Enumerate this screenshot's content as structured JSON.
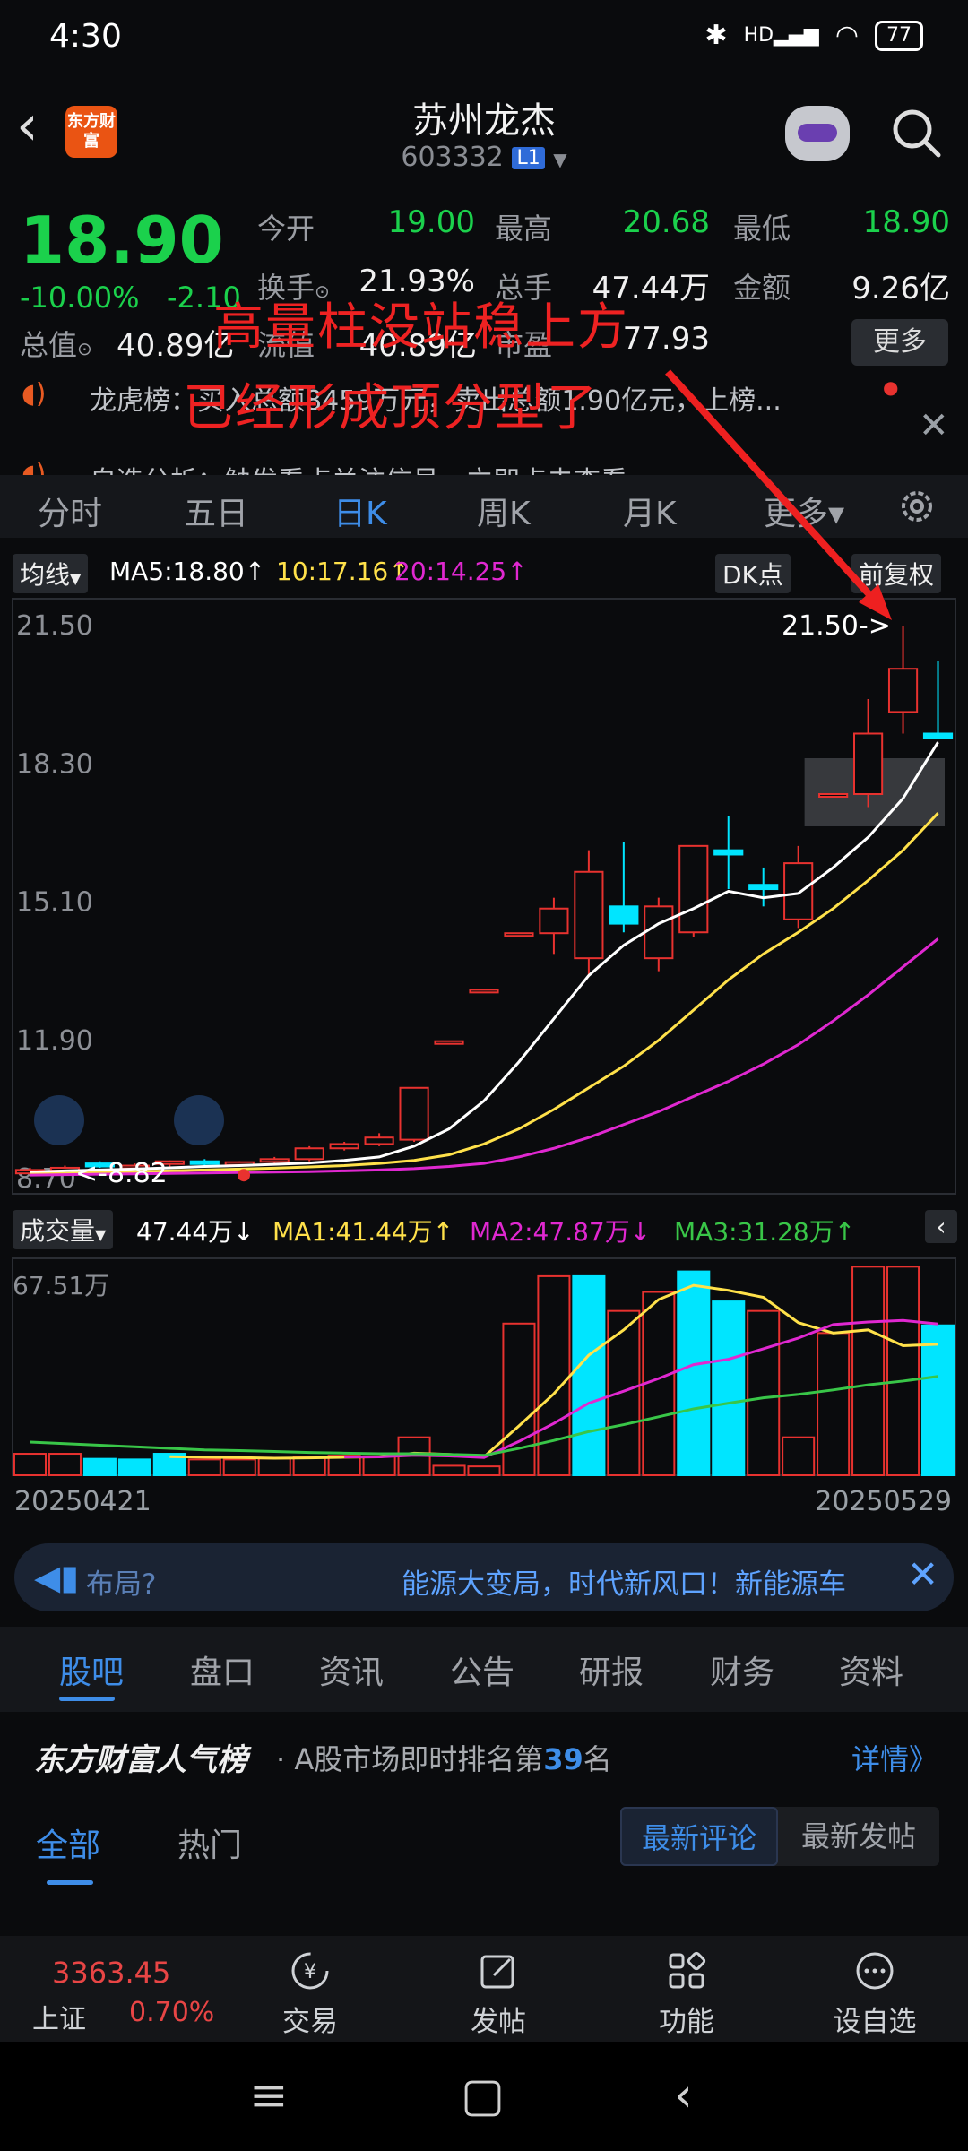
{
  "status_bar": {
    "time": "4:30",
    "network": "HD",
    "battery": "77"
  },
  "header": {
    "app_logo_text": "东方财富",
    "stock_name": "苏州龙杰",
    "stock_code": "603332",
    "level_badge": "L1"
  },
  "quote": {
    "price": "18.90",
    "change_pct": "-10.00%",
    "change": "-2.10",
    "fields": {
      "open_label": "今开",
      "open": "19.00",
      "high_label": "最高",
      "high": "20.68",
      "low_label": "最低",
      "low": "18.90",
      "turnover_label": "换手",
      "turnover": "21.93%",
      "volume_label": "总手",
      "volume": "47.44万",
      "amount_label": "金额",
      "amount": "9.26亿",
      "mcap_label": "总值",
      "mcap": "40.89亿",
      "float_label": "流值",
      "float": "40.89亿",
      "pe_label": "市盈",
      "pe": "77.93"
    },
    "more_label": "更多"
  },
  "annotations": {
    "line1": "高量柱没站稳上方",
    "line2": "已经形成顶分型了"
  },
  "tickers": [
    {
      "text": "龙虎榜：买入总额8459万元，卖出总额1.90亿元，上榜..."
    },
    {
      "text": "自选分析：触发看点关注信号，立即点击查看"
    }
  ],
  "period_tabs": [
    "分时",
    "五日",
    "日K",
    "周K",
    "月K",
    "更多▾"
  ],
  "active_period": "日K",
  "ma_legend": {
    "type_label": "均线",
    "ma5": "MA5:18.80",
    "ma10": "10:17.16",
    "ma20": "20:14.25",
    "dk_label": "DK点",
    "adjust_label": "前复权"
  },
  "kline_labels": {
    "y_ticks": [
      "21.50",
      "18.30",
      "15.10",
      "11.90",
      "8.70"
    ],
    "max_marker": "21.50->",
    "min_marker": "8.82"
  },
  "volume_legend": {
    "type_label": "成交量",
    "vol": "47.44万",
    "ma1": "MA1:41.44万",
    "ma2": "MA2:47.87万",
    "ma3": "MA3:31.28万",
    "y_max": "67.51万"
  },
  "date_range": {
    "start": "20250421",
    "end": "20250529"
  },
  "promo": {
    "prefix": "布局?",
    "text": "能源大变局，时代新风口！新能源车"
  },
  "section_tabs": [
    "股吧",
    "盘口",
    "资讯",
    "公告",
    "研报",
    "财务",
    "资料"
  ],
  "popularity": {
    "brand": "东方财富人气榜",
    "text_prefix": "· A股市场即时排名第",
    "rank": "39",
    "text_suffix": "名",
    "detail": "详情》"
  },
  "comment_tabs": [
    "全部",
    "热门"
  ],
  "sort_options": [
    "最新评论",
    "最新发帖"
  ],
  "bottom_nav": {
    "index_value": "3363.45",
    "index_name": "上证",
    "index_pct": "0.70%",
    "items": [
      "交易",
      "发帖",
      "功能",
      "设自选"
    ]
  },
  "colors": {
    "up": "#e8322f",
    "down": "#1bd14c",
    "cyan_candle": "#00e5ff",
    "accent": "#3e8de8"
  },
  "chart_data": [
    {
      "type": "candlestick",
      "title": "",
      "ylim": [
        8.7,
        21.5
      ],
      "y_ticks": [
        21.5,
        18.3,
        15.1,
        11.9,
        8.7
      ],
      "candles": [
        {
          "o": 8.82,
          "h": 8.95,
          "l": 8.82,
          "c": 8.9
        },
        {
          "o": 8.92,
          "h": 9.0,
          "l": 8.85,
          "c": 8.95
        },
        {
          "o": 9.05,
          "h": 9.1,
          "l": 8.95,
          "c": 8.98
        },
        {
          "o": 8.98,
          "h": 9.05,
          "l": 8.92,
          "c": 9.0
        },
        {
          "o": 9.05,
          "h": 9.12,
          "l": 8.95,
          "c": 9.1
        },
        {
          "o": 9.1,
          "h": 9.15,
          "l": 9.0,
          "c": 9.05
        },
        {
          "o": 9.05,
          "h": 9.1,
          "l": 8.98,
          "c": 9.08
        },
        {
          "o": 9.1,
          "h": 9.2,
          "l": 9.05,
          "c": 9.15
        },
        {
          "o": 9.15,
          "h": 9.45,
          "l": 9.1,
          "c": 9.4
        },
        {
          "o": 9.4,
          "h": 9.55,
          "l": 9.35,
          "c": 9.5
        },
        {
          "o": 9.5,
          "h": 9.75,
          "l": 9.45,
          "c": 9.65
        },
        {
          "o": 9.6,
          "h": 10.8,
          "l": 9.55,
          "c": 10.8
        },
        {
          "o": 11.88,
          "h": 11.88,
          "l": 11.88,
          "c": 11.88
        },
        {
          "o": 13.07,
          "h": 13.07,
          "l": 13.07,
          "c": 13.07
        },
        {
          "o": 14.38,
          "h": 14.38,
          "l": 14.38,
          "c": 14.38
        },
        {
          "o": 14.38,
          "h": 15.2,
          "l": 13.9,
          "c": 14.95
        },
        {
          "o": 13.8,
          "h": 16.3,
          "l": 13.4,
          "c": 15.8
        },
        {
          "o": 15.0,
          "h": 16.5,
          "l": 14.4,
          "c": 14.6
        },
        {
          "o": 13.8,
          "h": 15.2,
          "l": 13.5,
          "c": 15.0
        },
        {
          "o": 14.4,
          "h": 16.4,
          "l": 14.3,
          "c": 16.4
        },
        {
          "o": 16.3,
          "h": 17.1,
          "l": 15.4,
          "c": 16.2
        },
        {
          "o": 15.5,
          "h": 15.9,
          "l": 15.0,
          "c": 15.4
        },
        {
          "o": 14.7,
          "h": 16.4,
          "l": 14.5,
          "c": 16.0
        },
        {
          "o": 17.6,
          "h": 17.6,
          "l": 17.6,
          "c": 17.6
        },
        {
          "o": 17.6,
          "h": 19.8,
          "l": 17.3,
          "c": 19.0
        },
        {
          "o": 19.5,
          "h": 21.5,
          "l": 19.0,
          "c": 20.5
        },
        {
          "o": 19.0,
          "h": 20.68,
          "l": 18.9,
          "c": 18.9
        }
      ],
      "ma_series": [
        {
          "name": "MA5",
          "color": "#ffffff",
          "values": [
            8.85,
            8.88,
            8.9,
            8.92,
            8.95,
            8.98,
            9.0,
            9.03,
            9.06,
            9.12,
            9.2,
            9.45,
            9.85,
            10.5,
            11.4,
            12.4,
            13.4,
            14.1,
            14.6,
            14.95,
            15.35,
            15.2,
            15.3,
            15.9,
            16.6,
            17.5,
            18.8
          ]
        },
        {
          "name": "MA10",
          "color": "#ffe14a",
          "values": [
            8.8,
            8.82,
            8.84,
            8.86,
            8.88,
            8.9,
            8.92,
            8.94,
            8.97,
            9.0,
            9.05,
            9.12,
            9.25,
            9.5,
            9.85,
            10.3,
            10.8,
            11.3,
            11.9,
            12.6,
            13.3,
            13.9,
            14.4,
            14.95,
            15.6,
            16.3,
            17.16
          ]
        },
        {
          "name": "MA20",
          "color": "#e028d0",
          "values": [
            8.78,
            8.79,
            8.8,
            8.81,
            8.82,
            8.83,
            8.84,
            8.85,
            8.86,
            8.88,
            8.9,
            8.93,
            8.98,
            9.05,
            9.2,
            9.4,
            9.65,
            9.95,
            10.25,
            10.6,
            10.95,
            11.35,
            11.8,
            12.35,
            12.95,
            13.6,
            14.25
          ]
        }
      ]
    },
    {
      "type": "bar",
      "title": "成交量",
      "ylim": [
        0,
        67.51
      ],
      "values": [
        6.8,
        6.8,
        5.2,
        5.0,
        6.8,
        5.0,
        5.0,
        5.3,
        5.8,
        6.2,
        6.0,
        12.0,
        3.0,
        2.8,
        48.0,
        63.0,
        63.0,
        52.0,
        58.0,
        64.5,
        55.0,
        52.0,
        12.0,
        45.0,
        66.0,
        66.0,
        47.44
      ],
      "up": [
        true,
        true,
        false,
        false,
        false,
        true,
        true,
        true,
        true,
        true,
        true,
        true,
        true,
        true,
        true,
        true,
        false,
        true,
        true,
        false,
        false,
        true,
        true,
        true,
        true,
        true,
        false
      ],
      "ma_series": [
        {
          "name": "MA1",
          "color": "#ffe14a",
          "values": [
            null,
            null,
            null,
            null,
            5.9,
            5.7,
            5.6,
            5.4,
            5.5,
            5.7,
            5.8,
            7.0,
            6.6,
            5.8,
            15.6,
            25.8,
            38.0,
            46.0,
            55.6,
            60.1,
            58.5,
            56.3,
            48.3,
            45.0,
            46.0,
            41.0,
            41.44
          ]
        },
        {
          "name": "MA2",
          "color": "#e028d0",
          "values": [
            null,
            null,
            null,
            null,
            null,
            null,
            null,
            null,
            null,
            5.8,
            5.8,
            6.3,
            6.1,
            5.6,
            10.7,
            16.4,
            22.8,
            26.6,
            30.6,
            35.0,
            36.7,
            40.0,
            43.4,
            47.7,
            48.5,
            49.0,
            47.87
          ]
        },
        {
          "name": "MA3",
          "color": "#39c648",
          "values": [
            10.5,
            10.0,
            9.5,
            9.0,
            8.5,
            8.0,
            7.8,
            7.5,
            7.2,
            7.0,
            6.8,
            6.8,
            6.6,
            6.3,
            8.5,
            11.0,
            13.8,
            16.0,
            18.5,
            21.0,
            22.8,
            24.5,
            25.6,
            27.0,
            28.6,
            29.8,
            31.28
          ]
        }
      ]
    }
  ]
}
